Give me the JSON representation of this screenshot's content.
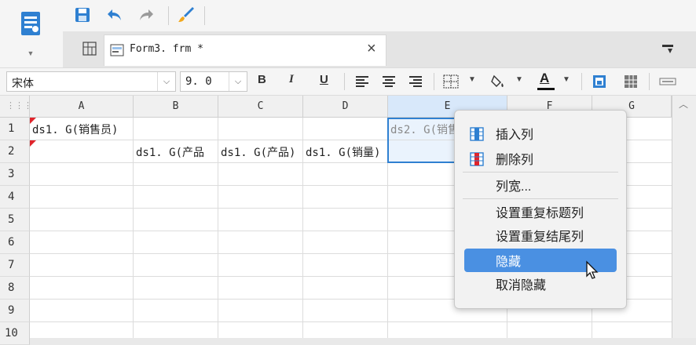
{
  "toolbar": {
    "save_icon": "save-icon",
    "undo_icon": "undo-icon",
    "redo_icon": "redo-icon",
    "format_painter_icon": "brush-icon"
  },
  "tab": {
    "label": "Form3. frm *",
    "close": "×"
  },
  "format": {
    "font_name": "宋体",
    "font_size": "9. 0",
    "bold": "B",
    "italic": "I",
    "underline": "U",
    "font_color_letter": "A"
  },
  "columns": [
    "A",
    "B",
    "C",
    "D",
    "E",
    "F",
    "G"
  ],
  "rows": [
    "1",
    "2",
    "3",
    "4",
    "5",
    "6",
    "7",
    "8",
    "9",
    "10"
  ],
  "cells": {
    "A1": "ds1. G(销售员)",
    "E1": "ds2. G(销售",
    "B2": "ds1. G(产品",
    "C2": "ds1. G(产品)",
    "D2": "ds1. G(销量)"
  },
  "context_menu": {
    "insert_col": "插入列",
    "delete_col": "删除列",
    "col_width": "列宽...",
    "repeat_header": "设置重复标题列",
    "repeat_footer": "设置重复结尾列",
    "hide": "隐藏",
    "unhide": "取消隐藏"
  },
  "colors": {
    "accent": "#2f80d1",
    "menu_highlight": "#4a90e2",
    "selected_header": "#d8e8fa"
  }
}
